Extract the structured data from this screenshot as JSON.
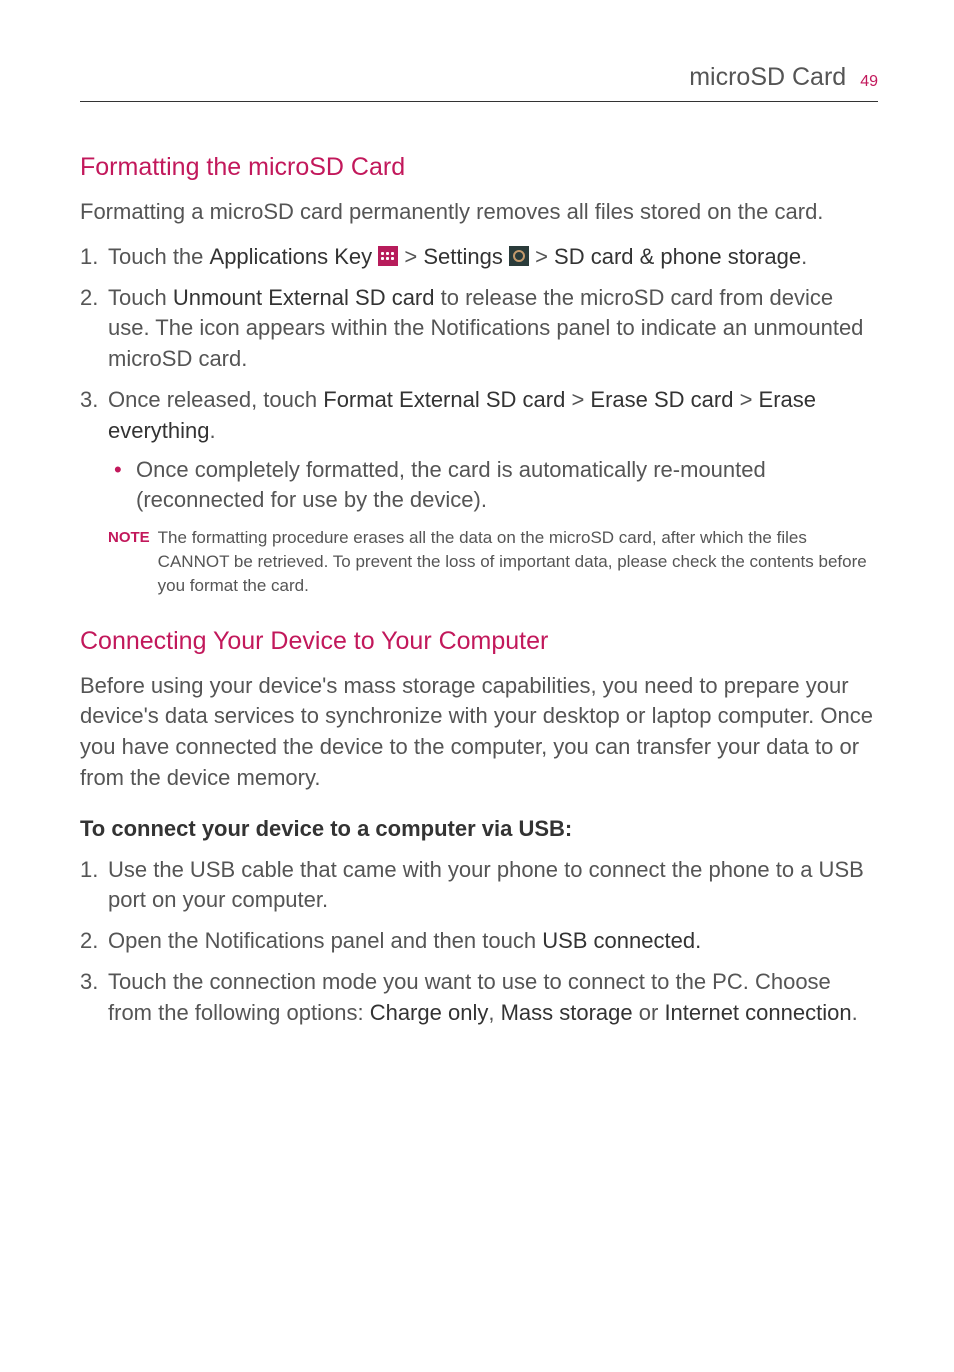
{
  "header": {
    "title": "microSD Card",
    "page": "49"
  },
  "section1": {
    "heading": "Formatting the microSD Card",
    "intro": "Formatting a microSD card permanently removes all files stored on the card.",
    "step1": {
      "p1": "Touch the ",
      "b1": "Applications Key ",
      "gt1": " > ",
      "b2": "Settings ",
      "gt2": " > ",
      "b3": "SD card & phone storage",
      "end": "."
    },
    "step2": {
      "p1": "Touch ",
      "b1": "Unmount External SD card",
      "p2": " to release the microSD card from device use. The icon appears within the Notifications panel to indicate an unmounted microSD card."
    },
    "step3": {
      "p1": "Once released, touch ",
      "b1": "Format External SD card",
      "gt1": " > ",
      "b2": "Erase SD card",
      "gt2": " > ",
      "b3": "Erase everything",
      "end": ".",
      "bullet": "Once completely formatted, the card is automatically re-mounted (reconnected for use by the device)."
    },
    "note_label": "NOTE",
    "note_text": "The formatting procedure erases all the data on the microSD card, after which the files CANNOT be retrieved. To prevent the loss of important data, please check the contents before you format the card."
  },
  "section2": {
    "heading": "Connecting Your Device to Your Computer",
    "intro": "Before using your device's mass storage capabilities, you need to prepare your device's data services to synchronize with your desktop or laptop computer. Once you have connected the device to the computer, you can transfer your data to or from the device memory.",
    "subheading": "To connect your device to a computer via USB:",
    "step1": "Use the USB cable that came with your phone to connect the phone to a USB port on your computer.",
    "step2": {
      "p1": "Open the Notifications panel and then touch ",
      "b1": "USB connected."
    },
    "step3": {
      "p1": "Touch the connection mode you want to use to connect to the PC. Choose from the following options: ",
      "b1": "Charge only",
      "c1": ", ",
      "b2": "Mass storage",
      "c2": " or ",
      "b3": "Internet connection",
      "end": "."
    }
  }
}
